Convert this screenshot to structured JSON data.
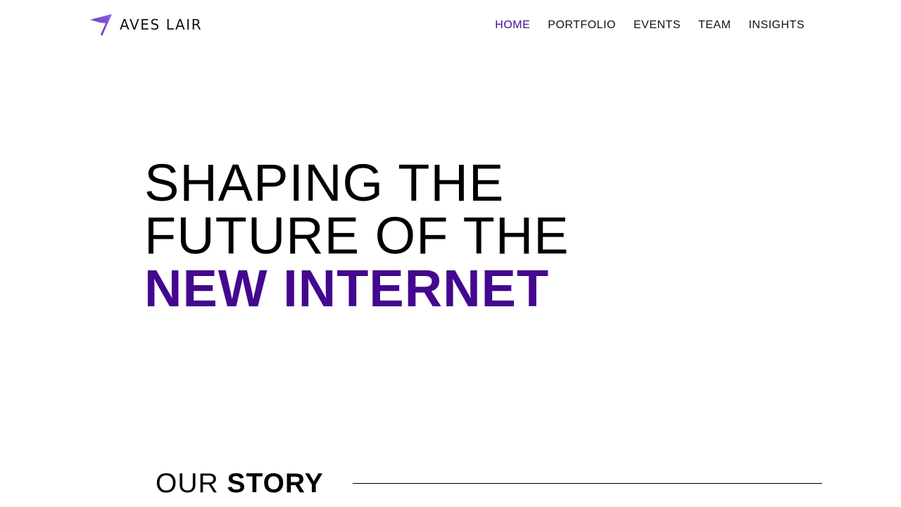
{
  "brand": {
    "name": "AVES LAIR",
    "accent_color": "#4a0c97",
    "logo_icon": "arrow-logo-icon"
  },
  "nav": {
    "items": [
      {
        "label": "HOME",
        "active": true
      },
      {
        "label": "PORTFOLIO",
        "active": false
      },
      {
        "label": "EVENTS",
        "active": false
      },
      {
        "label": "TEAM",
        "active": false
      },
      {
        "label": "INSIGHTS",
        "active": false
      }
    ]
  },
  "hero": {
    "line1": "SHAPING THE",
    "line2": "FUTURE OF THE",
    "line3": "NEW INTERNET"
  },
  "story": {
    "word1": "OUR",
    "word2": "STORY"
  }
}
